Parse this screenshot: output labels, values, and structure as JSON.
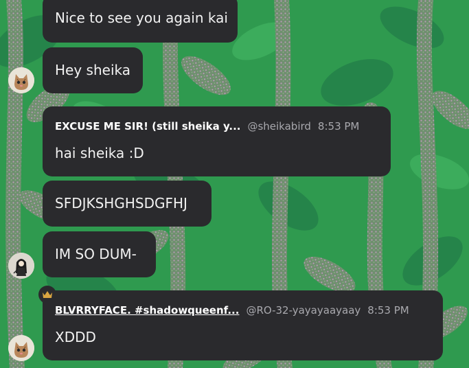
{
  "messages": [
    {
      "text": "Nice to see you again kai"
    },
    {
      "text": "Hey sheika"
    },
    {
      "name": "EXCUSE ME SIR! (still sheika y...",
      "handle": "@sheikabird",
      "time": "8:53 PM",
      "text": "hai sheika :D"
    },
    {
      "text": "SFDJKSHGHSDGFHJ"
    },
    {
      "text": "IM SO DUM-"
    },
    {
      "name": "BLVRRYFACE. #shadowqueenf...",
      "handle": "@RO-32-yayayaayaay",
      "time": "8:53 PM",
      "text": "XDDD"
    }
  ],
  "colors": {
    "bubble": "#2a2a2d",
    "background": "#2f9a4f",
    "crown": "#d9a441"
  },
  "icons": [
    "cat-avatar-icon",
    "anime-avatar-icon",
    "crown-icon"
  ]
}
